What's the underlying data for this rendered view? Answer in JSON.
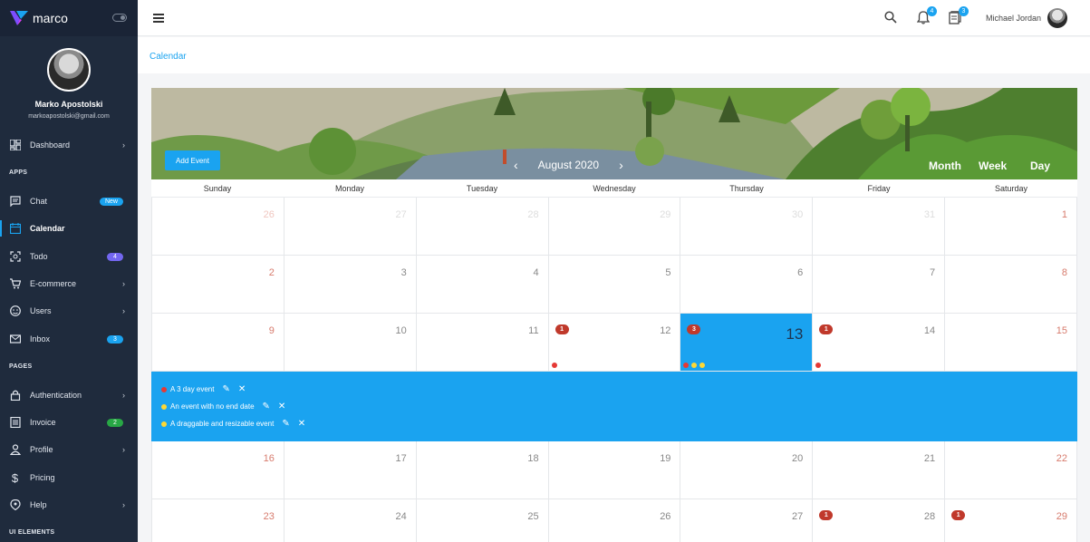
{
  "brand": {
    "name": "marco"
  },
  "user": {
    "name": "Marko Apostolski",
    "email": "markoapostolski@gmail.com"
  },
  "sections": {
    "apps": "APPS",
    "pages": "PAGES",
    "ui_elements": "UI ELEMENTS"
  },
  "nav": [
    {
      "label": "Dashboard",
      "icon": "dashboard-icon",
      "chevron": true
    },
    {
      "label": "Chat",
      "icon": "chat-icon",
      "badge": "New",
      "badge_color": "#1aa3f0"
    },
    {
      "label": "Calendar",
      "icon": "calendar-icon",
      "active": true
    },
    {
      "label": "Todo",
      "icon": "todo-icon",
      "badge": "4",
      "badge_color": "#7367f0"
    },
    {
      "label": "E-commerce",
      "icon": "cart-icon",
      "chevron": true
    },
    {
      "label": "Users",
      "icon": "users-icon",
      "chevron": true
    },
    {
      "label": "Inbox",
      "icon": "mail-icon",
      "badge": "3",
      "badge_color": "#1aa3f0"
    },
    {
      "label": "Authentication",
      "icon": "lock-icon",
      "chevron": true
    },
    {
      "label": "Invoice",
      "icon": "invoice-icon",
      "badge": "2",
      "badge_color": "#28a745"
    },
    {
      "label": "Profile",
      "icon": "person-icon",
      "chevron": true
    },
    {
      "label": "Pricing",
      "icon": "dollar-icon"
    },
    {
      "label": "Help",
      "icon": "help-icon",
      "chevron": true
    }
  ],
  "topbar": {
    "notifications_count": "4",
    "messages_count": "3",
    "user_name": "Michael Jordan"
  },
  "breadcrumb": "Calendar",
  "calendar": {
    "add_event": "Add Event",
    "month": "August 2020",
    "prev": "‹",
    "next": "›",
    "views": [
      "Month",
      "Week",
      "Day"
    ],
    "days_of_week": [
      "Sunday",
      "Monday",
      "Tuesday",
      "Wednesday",
      "Thursday",
      "Friday",
      "Saturday"
    ],
    "weeks": [
      [
        "26",
        "27",
        "28",
        "29",
        "30",
        "31",
        "1"
      ],
      [
        "2",
        "3",
        "4",
        "5",
        "6",
        "7",
        "8"
      ],
      [
        "9",
        "10",
        "11",
        "12",
        "13",
        "14",
        "15"
      ],
      [
        "16",
        "17",
        "18",
        "19",
        "20",
        "21",
        "22"
      ],
      [
        "23",
        "24",
        "25",
        "26",
        "27",
        "28",
        "29"
      ]
    ],
    "badges": {
      "w2d3": "1",
      "w2d4": "3",
      "w2d5": "1",
      "w4d5": "1",
      "w4d6": "1"
    },
    "events": [
      {
        "title": "A 3 day event",
        "color": "#e53935"
      },
      {
        "title": "An event with no end date",
        "color": "#fdd835"
      },
      {
        "title": "A draggable and resizable event",
        "color": "#fdd835"
      }
    ]
  },
  "colors": {
    "accent": "#1aa3f0",
    "sidebar": "#1f2b3d",
    "weekend": "#d77b6d",
    "badge": "#c0392b"
  }
}
